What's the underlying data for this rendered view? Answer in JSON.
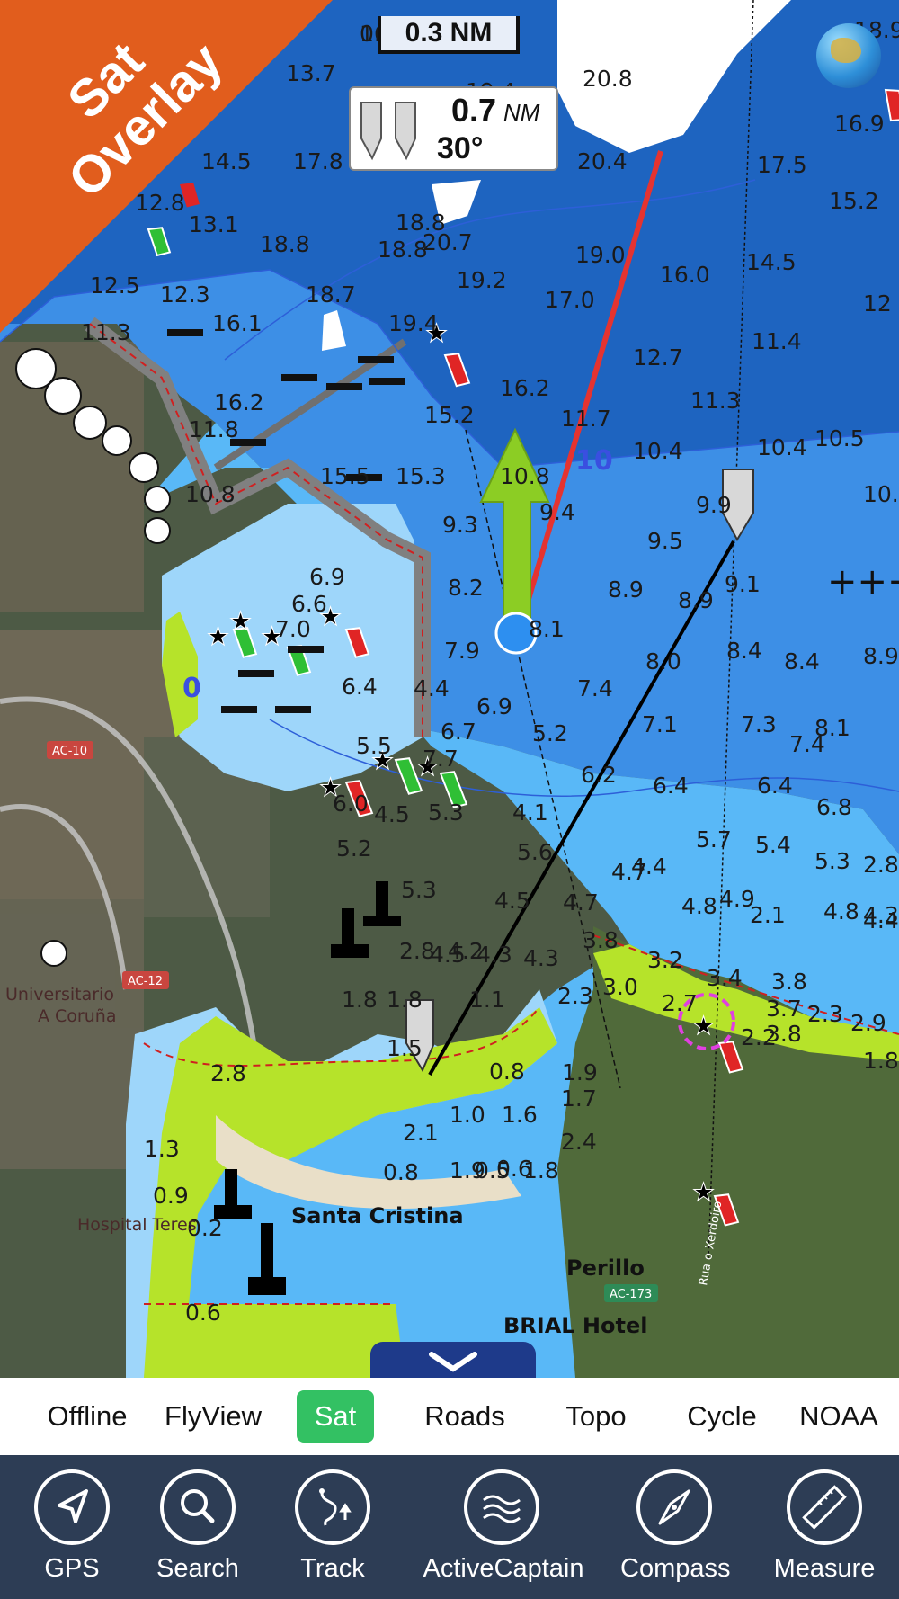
{
  "badge": {
    "line1": "Sat",
    "line2": "Overlay"
  },
  "scale": {
    "label": "0.3 NM"
  },
  "measurement": {
    "distance": "0.7",
    "unit": "NM",
    "bearing": "30°"
  },
  "icons": {
    "globe": "globe-icon",
    "gps": "navigation-arrow-icon",
    "search": "magnifier-icon",
    "track": "track-path-icon",
    "activecaptain": "wave-icon",
    "compass": "compass-icon",
    "measure": "ruler-icon"
  },
  "map_labels": {
    "place1": "Santa Cristina",
    "place2": "Perillo",
    "place3": "BRIAL Hotel",
    "place4": "Universitario",
    "place5": "A Coruña",
    "place6": "Hospital Teres",
    "road1": "AC-10",
    "road2": "AC-12",
    "road3": "AC-173",
    "road4": "Rua o Xerdoiro",
    "contour10": "10",
    "contour0": "0"
  },
  "soundings": [
    "16.9",
    "13.7",
    "19.4",
    "20.8",
    "18.9",
    "16.9",
    "14.5",
    "17.8",
    "20.4",
    "17.5",
    "15.2",
    "12.8",
    "13.1",
    "18.8",
    "18.8",
    "20.7",
    "18.8",
    "14.5",
    "12.5",
    "12.3",
    "18.7",
    "19.2",
    "19.0",
    "16.0",
    "17.0",
    "12",
    "11.3",
    "16.1",
    "19.4",
    "12.7",
    "11.4",
    "16.2",
    "16.2",
    "15.2",
    "11.7",
    "11.3",
    "11.8",
    "10.4",
    "10.4",
    "10.5",
    "15.5",
    "15.3",
    "10.8",
    "10.8",
    "9.4",
    "9.3",
    "9.9",
    "10.2",
    "9.5",
    "9.1",
    "8.9",
    "8.9",
    "8.2",
    "8.1",
    "6.9",
    "6.6",
    "7.0",
    "7.9",
    "8.4",
    "8.4",
    "8.9",
    "6.4",
    "4.4",
    "6.9",
    "7.4",
    "8.0",
    "7.1",
    "7.3",
    "7.4",
    "8.1",
    "5.5",
    "6.7",
    "5.2",
    "6.2",
    "6.4",
    "6.4",
    "6.8",
    "7.7",
    "4.1",
    "5.7",
    "5.4",
    "5.3",
    "2.8",
    "6.0",
    "4.5",
    "5.3",
    "5.6",
    "5.2",
    "5.3",
    "4.5",
    "4.7",
    "4.7",
    "4.4",
    "4.8",
    "4.9",
    "2.1",
    "4.8",
    "4.3",
    "4.4",
    "2.8",
    "4.2",
    "4.3",
    "3.8",
    "3.2",
    "3.4",
    "3.8",
    "3.8",
    "4.5",
    "4.3",
    "1.8",
    "1.8",
    "1.1",
    "2.3",
    "3.0",
    "2.7",
    "3.7",
    "2.3",
    "2.2",
    "2.9",
    "1.8",
    "1.5",
    "0.8",
    "1.9",
    "2.8",
    "1.7",
    "1.0",
    "1.6",
    "2.1",
    "2.4",
    "0.5",
    "1.3",
    "0.6",
    "0.8",
    "1.9",
    "1.8",
    "0.9",
    "0.2",
    "0.6",
    "0.8"
  ],
  "layers": [
    {
      "label": "Offline",
      "active": false
    },
    {
      "label": "FlyView",
      "active": false
    },
    {
      "label": "Sat",
      "active": true
    },
    {
      "label": "Roads",
      "active": false
    },
    {
      "label": "Topo",
      "active": false
    },
    {
      "label": "Cycle",
      "active": false
    },
    {
      "label": "NOAA",
      "active": false
    }
  ],
  "toolbar": [
    {
      "label": "GPS",
      "icon": "navigation-arrow-icon"
    },
    {
      "label": "Search",
      "icon": "magnifier-icon"
    },
    {
      "label": "Track",
      "icon": "track-path-icon"
    },
    {
      "label": "ActiveCaptain",
      "icon": "wave-icon"
    },
    {
      "label": "Compass",
      "icon": "compass-icon"
    },
    {
      "label": "Measure",
      "icon": "ruler-icon"
    }
  ],
  "colors": {
    "deep_water": "#1e64c0",
    "mid_water": "#3d8fe6",
    "shallow_water": "#59b8f7",
    "very_shallow": "#9ed6fa",
    "intertidal": "#b6e32a",
    "badge": "#e15d1d",
    "active_tab": "#33c163",
    "toolbar_bg": "#2d3d55"
  }
}
